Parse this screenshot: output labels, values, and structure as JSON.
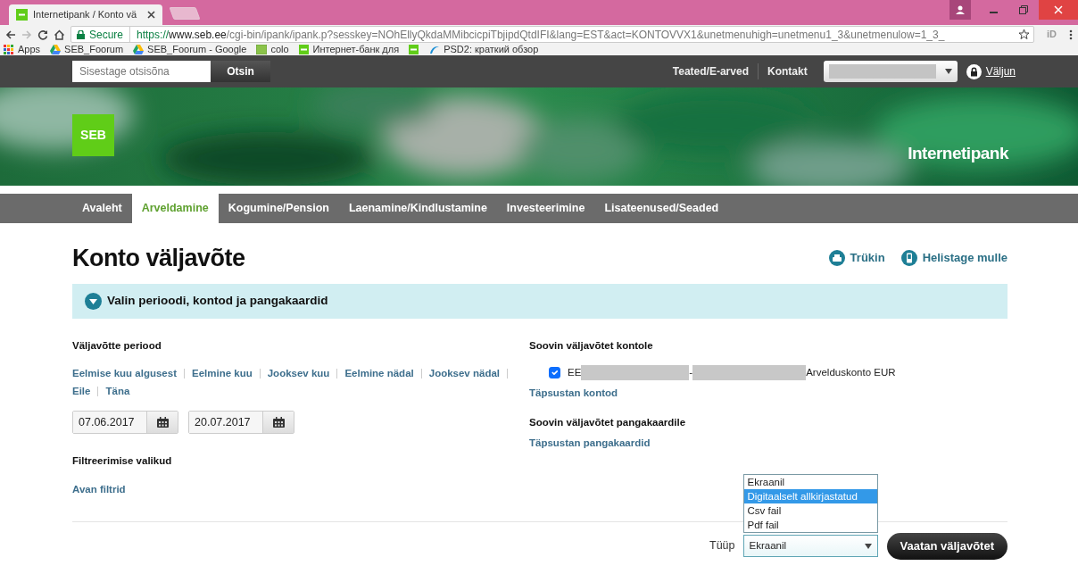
{
  "browser": {
    "tab_title": "Internetipank / Konto vä",
    "secure_label": "Secure",
    "url_scheme": "https://",
    "url_host": "www.seb.ee",
    "url_path": "/cgi-bin/ipank/ipank.p?sesskey=NOhEllyQkdaMMibcicpiTbjipdQtdIFI&lang=EST&act=KONTOVVX1&unetmenuhigh=unetmenu1_3&unetmenulow=1_3_",
    "extension_label": "iD",
    "bookmarks": [
      {
        "label": "Apps",
        "kind": "apps"
      },
      {
        "label": "SEB_Foorum",
        "kind": "drive"
      },
      {
        "label": "SEB_Foorum - Google",
        "kind": "drive"
      },
      {
        "label": "colo",
        "kind": "sheet"
      },
      {
        "label": "Интернет-банк для",
        "kind": "seb"
      },
      {
        "kind": "seb"
      },
      {
        "label": "PSD2: краткий обзор",
        "kind": "swirl"
      }
    ]
  },
  "site": {
    "search_placeholder": "Sisestage otsisõna",
    "search_button": "Otsin",
    "top_links": [
      "Teated/E-arved",
      "Kontakt"
    ],
    "logout": "Väljun",
    "logo": "SEB",
    "banner_title": "Internetipank",
    "nav": [
      {
        "label": "Avaleht",
        "selected": false
      },
      {
        "label": "Arveldamine",
        "selected": true
      },
      {
        "label": "Kogumine/Pension",
        "selected": false
      },
      {
        "label": "Laenamine/Kindlustamine",
        "selected": false
      },
      {
        "label": "Investeerimine",
        "selected": false
      },
      {
        "label": "Lisateenused/Seaded",
        "selected": false
      }
    ]
  },
  "page": {
    "title": "Konto väljavõte",
    "actions": [
      {
        "label": "Trükin",
        "kind": "print"
      },
      {
        "label": "Helistage mulle",
        "kind": "phone"
      }
    ],
    "section_title": "Valin perioodi, kontod ja pangakaardid",
    "period_label": "Väljavõtte periood",
    "quick_links": [
      [
        "Eelmise kuu algusest",
        "Eelmine kuu",
        "Jooksev kuu",
        "Eelmine nädal",
        "Jooksev nädal"
      ],
      [
        "Eile",
        "Täna"
      ]
    ],
    "date_from": "07.06.2017",
    "date_to": "20.07.2017",
    "filter_label": "Filtreerimise valikud",
    "filter_link": "Avan filtrid",
    "account_label": "Soovin väljavõtet kontole",
    "account": {
      "checked": true,
      "prefix": "EE",
      "separator": "-",
      "name": "Arvelduskonto EUR"
    },
    "account_link": "Täpsustan kontod",
    "cards_label": "Soovin väljavõtet pangakaardile",
    "cards_link": "Täpsustan pangakaardid",
    "type_label": "Tüüp",
    "type_value": "Ekraanil",
    "type_options": [
      {
        "label": "Ekraanil",
        "selected": false
      },
      {
        "label": "Digitaalselt allkirjastatud",
        "selected": true
      },
      {
        "label": "Csv fail",
        "selected": false
      },
      {
        "label": "Pdf fail",
        "selected": false
      }
    ],
    "submit": "Vaatan väljavõtet"
  }
}
